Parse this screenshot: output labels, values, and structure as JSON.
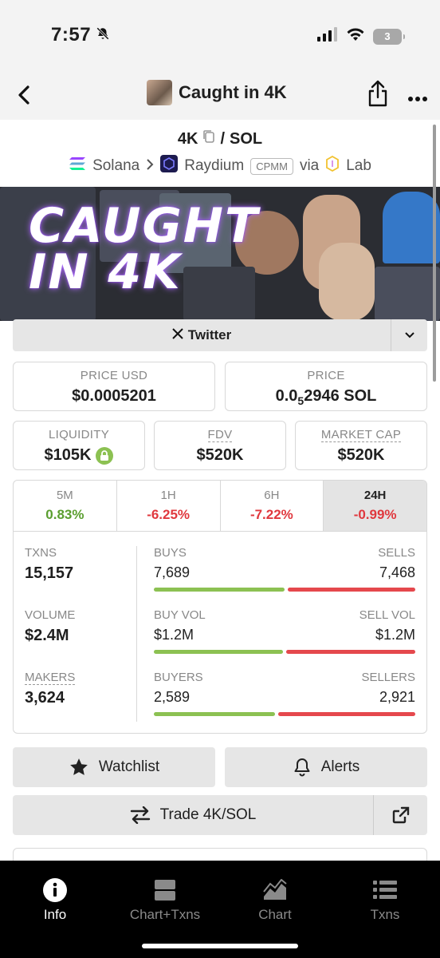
{
  "status_bar": {
    "time": "7:57",
    "battery": "3"
  },
  "nav": {
    "title": "Caught in 4K"
  },
  "pair": {
    "base": "4K",
    "separator": "/",
    "quote": "SOL"
  },
  "chain": {
    "chain": "Solana",
    "dex": "Raydium",
    "badge": "CPMM",
    "via": "via",
    "lab": "Lab"
  },
  "banner": {
    "text_line1": "CAUGHT",
    "text_line2": "IN 4K"
  },
  "social": {
    "twitter_label": "Twitter"
  },
  "price": {
    "usd_label": "PRICE USD",
    "usd_value": "$0.0005201",
    "native_label": "PRICE",
    "native_prefix": "0.0",
    "native_sub": "5",
    "native_digits": "2946 SOL"
  },
  "metrics": {
    "liquidity_label": "LIQUIDITY",
    "liquidity_value": "$105K",
    "fdv_label": "FDV",
    "fdv_value": "$520K",
    "mcap_label": "MARKET CAP",
    "mcap_value": "$520K"
  },
  "timeframes": [
    {
      "label": "5M",
      "value": "0.83%"
    },
    {
      "label": "1H",
      "value": "-6.25%"
    },
    {
      "label": "6H",
      "value": "-7.22%"
    },
    {
      "label": "24H",
      "value": "-0.99%"
    }
  ],
  "stats": {
    "txns_label": "TXNS",
    "txns_value": "15,157",
    "volume_label": "VOLUME",
    "volume_value": "$2.4M",
    "makers_label": "MAKERS",
    "makers_value": "3,624",
    "buys_label": "BUYS",
    "buys_value": "7,689",
    "sells_label": "SELLS",
    "sells_value": "7,468",
    "buy_vol_label": "BUY VOL",
    "buy_vol_value": "$1.2M",
    "sell_vol_label": "SELL VOL",
    "sell_vol_value": "$1.2M",
    "buyers_label": "BUYERS",
    "buyers_value": "2,589",
    "sellers_label": "SELLERS",
    "sellers_value": "2,921",
    "buy_ratio": 0.507,
    "buy_vol_ratio": 0.5,
    "buyer_ratio": 0.47
  },
  "actions": {
    "watchlist": "Watchlist",
    "alerts": "Alerts",
    "trade": "Trade 4K/SOL"
  },
  "tabbar": {
    "info": "Info",
    "chart_txns": "Chart+Txns",
    "chart": "Chart",
    "txns": "Txns"
  },
  "colors": {
    "green": "#5a9e2f",
    "red": "#e0383e",
    "bar_green": "#8cc152",
    "bar_red": "#e5484d"
  }
}
